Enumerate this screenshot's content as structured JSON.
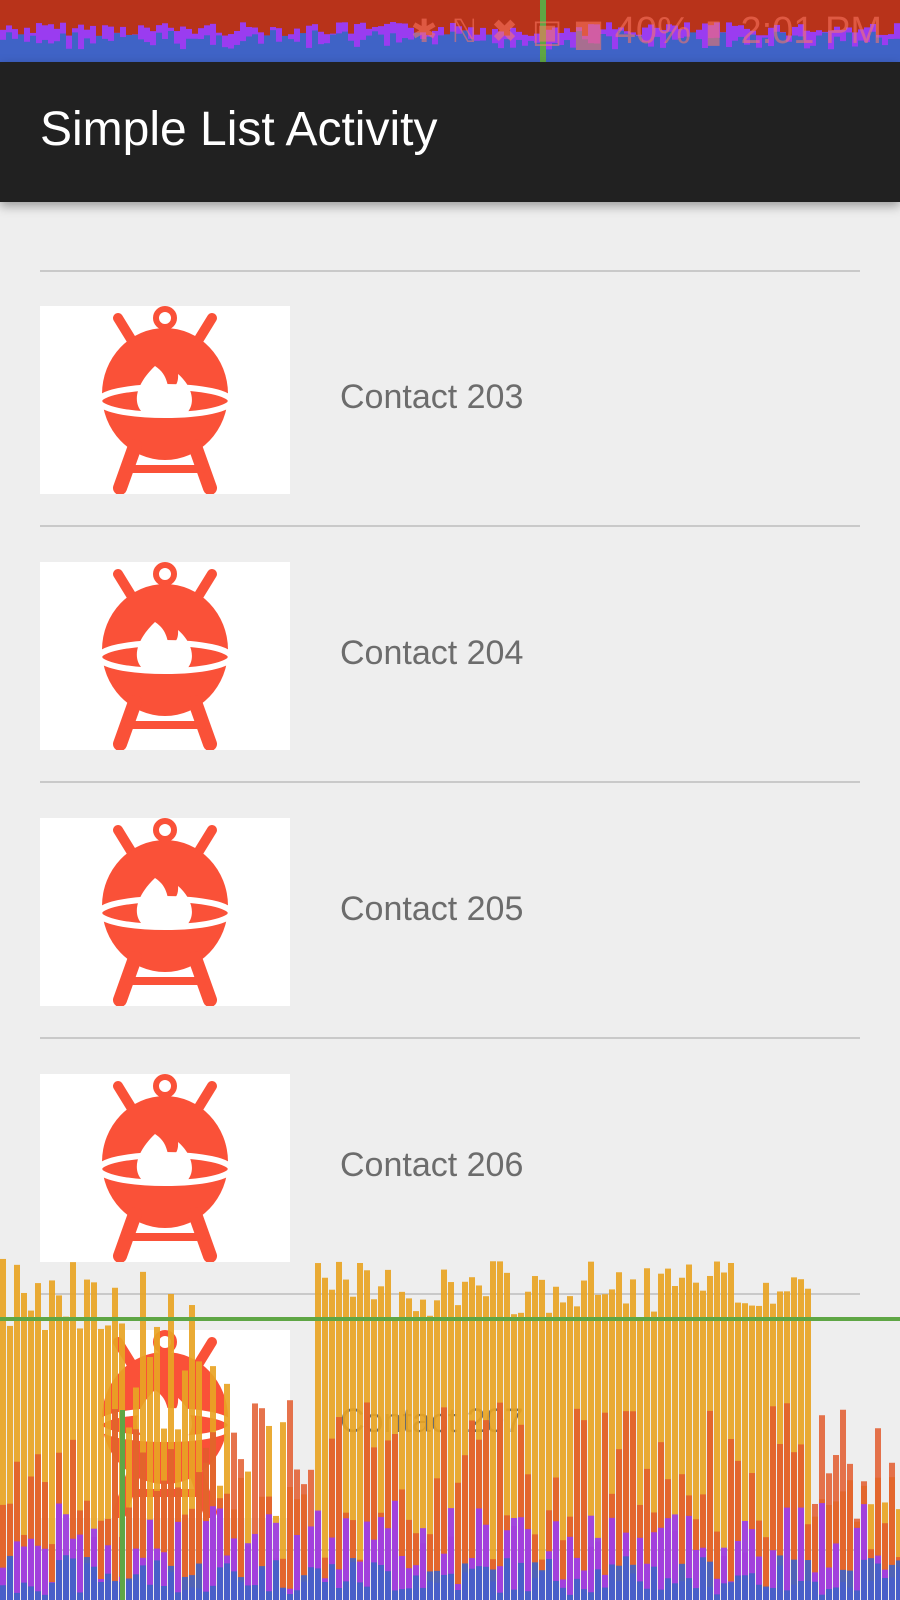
{
  "status_bar": {
    "icons": [
      "bluetooth-icon",
      "nfc-icon",
      "mute-icon",
      "lte-icon",
      "signal-icon",
      "battery-icon"
    ],
    "battery": "40%",
    "time": "2:01 PM"
  },
  "app_bar": {
    "title": "Simple List Activity"
  },
  "contacts": [
    {
      "name": "Contact 203",
      "icon": "grill-icon"
    },
    {
      "name": "Contact 204",
      "icon": "grill-icon"
    },
    {
      "name": "Contact 205",
      "icon": "grill-icon"
    },
    {
      "name": "Contact 206",
      "icon": "grill-icon"
    },
    {
      "name": "Contact 207",
      "icon": "grill-icon"
    }
  ],
  "colors": {
    "app_bar": "#212121",
    "background": "#eeeeee",
    "icon": "#fa5138",
    "text": "#6c6c6c",
    "gpu_orange": "#e8a424",
    "gpu_red": "#e25b2d",
    "gpu_purple": "#9a3cf0",
    "gpu_blue": "#3f63c6",
    "gpu_green": "#5fa645"
  }
}
